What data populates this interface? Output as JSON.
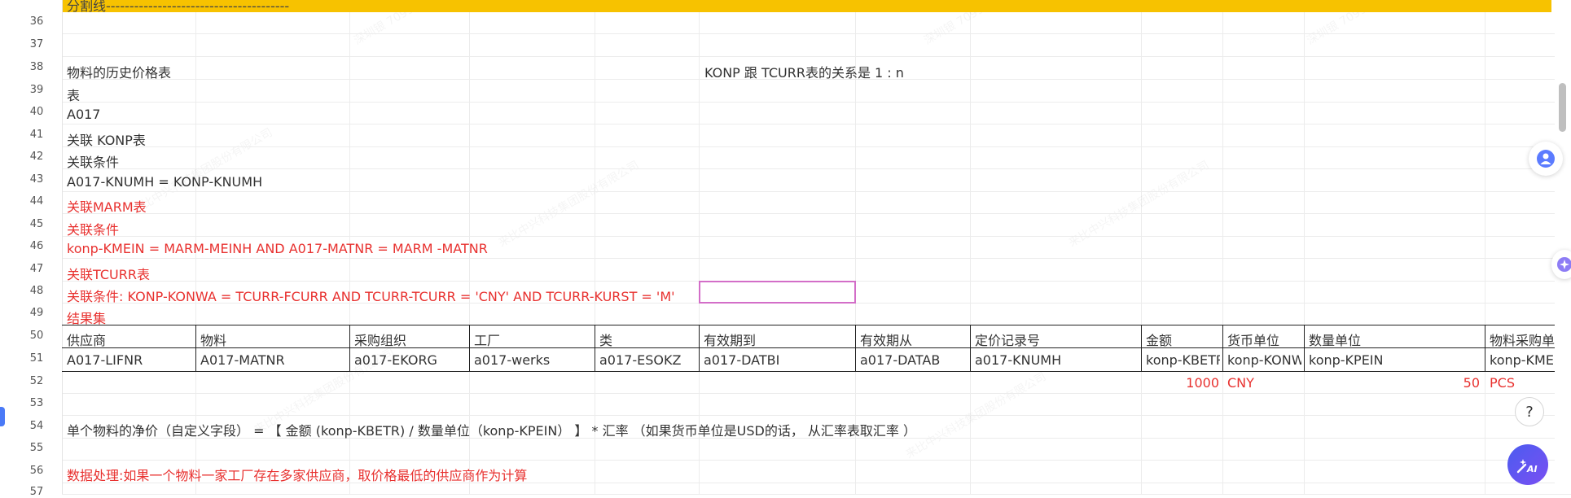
{
  "banner": {
    "text": "分割线---------------------------------------"
  },
  "row_numbers": [
    "36",
    "37",
    "38",
    "39",
    "40",
    "41",
    "42",
    "43",
    "44",
    "45",
    "46",
    "47",
    "48",
    "49",
    "50",
    "51",
    "52",
    "53",
    "54",
    "55",
    "56",
    "57"
  ],
  "rows": {
    "r38_a": "物料的历史价格表",
    "r38_f": "KONP 跟 TCURR表的关系是 1 : n",
    "r39": "表",
    "r40": "A017",
    "r41": "关联 KONP表",
    "r42": "关联条件",
    "r43": "A017-KNUMH  =  KONP-KNUMH",
    "r44": "关联MARM表",
    "r45": "关联条件",
    "r46": "konp-KMEIN  = MARM-MEINH  AND  A017-MATNR  =  MARM -MATNR",
    "r47": "关联TCURR表",
    "r48": "关联条件:  KONP-KONWA =  TCURR-FCURR  AND  TCURR-TCURR    =  'CNY'   AND  TCURR-KURST  = 'M'",
    "r49": "结果集",
    "r54": "单个物料的净价（自定义字段） =    【 金额   (konp-KBETR)  /  数量单位（konp-KPEIN） 】  * 汇率   （如果货币单位是USD的话，  从汇率表取汇率  ）",
    "r56": "数据处理:如果一个物料一家工厂存在多家供应商，取价格最低的供应商作为计算"
  },
  "table": {
    "headers": [
      "供应商",
      "物料",
      "采购组织",
      "工厂",
      "类",
      "有效期到",
      "有效期从",
      "定价记录号",
      "金额",
      "货币单位",
      "数量单位",
      "物料采购单"
    ],
    "fields": [
      "A017-LIFNR",
      "A017-MATNR",
      "a017-EKORG",
      "a017-werks",
      "a017-ESOKZ",
      "a017-DATBI",
      "a017-DATAB",
      "a017-KNUMH",
      "konp-KBETR",
      "konp-KONW",
      "konp-KPEIN",
      "konp-KME"
    ],
    "sample": {
      "amount": "1000",
      "currency": "CNY",
      "qty": "50",
      "unit": "PCS"
    }
  }
}
